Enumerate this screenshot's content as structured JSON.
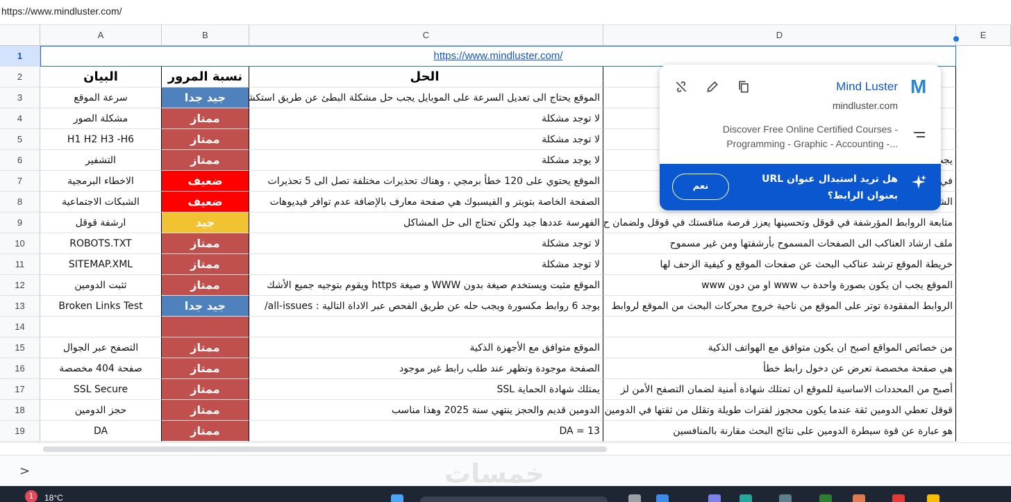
{
  "formula_bar": {
    "text": "https://www.mindluster.com/"
  },
  "columns": [
    "A",
    "B",
    "C",
    "D",
    "E"
  ],
  "row1": {
    "num": "1",
    "link": "https://www.mindluster.com/"
  },
  "header_row": {
    "num": "2",
    "a": "البيان",
    "b": "نسبة المرور",
    "c": "الحل",
    "d": ""
  },
  "rows": [
    {
      "num": "3",
      "a": "سرعة الموقع",
      "b": "جيد جدا",
      "b_color": "#4f81bd",
      "c": "الموقع يحتاج الى تعديل السرعة على الموبايل يجب حل مشكلة البطئ عن طريق استكشاف",
      "d": ""
    },
    {
      "num": "4",
      "a": "مشكلة الصور",
      "b": "ممتاز",
      "b_color": "#c0504d",
      "c": "لا توجد مشكلة",
      "d": ""
    },
    {
      "num": "5",
      "a": "H1 H2 H3 -H6",
      "b": "ممتاز",
      "b_color": "#c0504d",
      "c": "لا توجد مشكلة",
      "d": ""
    },
    {
      "num": "6",
      "a": "التشفير",
      "b": "ممتاز",
      "b_color": "#c0504d",
      "c": "لا يوجد مشكلة",
      "d": "يجب"
    },
    {
      "num": "7",
      "a": "الاخطاء البرمجية",
      "b": "ضعيف",
      "b_color": "#ff0000",
      "c": "الموقع يحتوي على 120 خطأ برمجي ، وهناك تحذيرات مختلفة تصل الى 5 تحذيرات",
      "d": "في الأرشفة وال"
    },
    {
      "num": "8",
      "a": "الشبكات الاجتماعية",
      "b": "ضعيف",
      "b_color": "#ff0000",
      "c": "الصفحة الخاصة بتويتر و الفيسبوك هي صفحة معارف بالإضافة عدم توافر فيديوهات",
      "d": "الشبكا"
    },
    {
      "num": "9",
      "a": "ارشفة قوقل",
      "b": "جيد",
      "b_color": "#f1c232",
      "c": "الفهرسة عددها جيد ولكن تحتاج الى حل المشاكل",
      "d": "متابعة الروابط المؤرشفة في قوقل وتحسينها يعزز فرصة منافستك في قوقل ولضمان ح"
    },
    {
      "num": "10",
      "a": "ROBOTS.TXT",
      "b": "ممتاز",
      "b_color": "#c0504d",
      "c": "لا توجد مشكلة",
      "d": "ملف ارشاد العناكب الى الصفحات المسموح بأرشفتها ومن غير مسموح"
    },
    {
      "num": "11",
      "a": "SITEMAP.XML",
      "b": "ممتاز",
      "b_color": "#c0504d",
      "c": "لا توجد مشكلة",
      "d": "خريطة الموقع ترشد عناكب البحث عن صفحات الموقع و كيفية الزحف لها"
    },
    {
      "num": "12",
      "a": "ثثبت الدومين",
      "b": "ممتاز",
      "b_color": "#c0504d",
      "c": "الموقع مثبت ويستخدم صيغة بدون WWW و صيغة https ويقوم بتوجيه جميع الأشك",
      "d": "الموقع يجب ان يكون بصورة واحدة ب www او من دون www"
    },
    {
      "num": "13",
      "a": "Broken Links Test",
      "b": "جيد جدا",
      "b_color": "#4f81bd",
      "c": "يوجد 6 روابط مكسورة ويجب حله عن طريق الفحص عبر الاداة التالية : all-issues/",
      "d": "الروابط المفقودة توتر على الموقع من ناحية خروج محركات البحث من الموقع لروابط"
    },
    {
      "num": "14",
      "a": "",
      "b": "",
      "b_color": "#c0504d",
      "c": "",
      "d": ""
    },
    {
      "num": "15",
      "a": "التصفح عبر الجوال",
      "b": "ممتاز",
      "b_color": "#c0504d",
      "c": "الموقع متوافق مع الأجهزة الذكية",
      "d": "من خصائص المواقع اصبح ان يكون متوافق مع الهواتف الذكية"
    },
    {
      "num": "16",
      "a": "صفحة 404 مخصصة",
      "b": "ممتاز",
      "b_color": "#c0504d",
      "c": "الصفحة موجودة وتظهر عند طلب رابط غير موجود",
      "d": "هي صفحة مخصصة تعرض عن دخول رابط خطأ"
    },
    {
      "num": "17",
      "a": "SSL Secure",
      "b": "ممتاز",
      "b_color": "#c0504d",
      "c": "يمتلك شهادة الحماية SSL",
      "d": "أصبح من المحددات الاساسية للموقع ان تمتلك شهادة أمنية لضمان التصفح الأمن لز"
    },
    {
      "num": "18",
      "a": "حجز الدومين",
      "b": "ممتاز",
      "b_color": "#c0504d",
      "c": "الدومين قديم والحجز ينتهي سنة 2025 وهذا مناسب",
      "d": "قوقل تعطي الدومين ثقة عندما يكون محجوز لفترات طويلة وتقلل من ثقتها في الدومين"
    },
    {
      "num": "19",
      "a": "DA",
      "b": "ممتاز",
      "b_color": "#c0504d",
      "c": "DA = 13",
      "d": "هو عبارة عن قوة سيطرة الدومين على نتائج البحث مقارنة بالمنافسين"
    }
  ],
  "link_popup": {
    "title": "Mind Luster",
    "domain": "mindluster.com",
    "description": "Discover Free Online Certified Courses - Programming - Graphic - Accounting -...",
    "banner_text": "هل تريد استبدال عنوان URL بعنوان الرابط؟",
    "yes_label": "نعم",
    "logo_letter": "M",
    "icons": [
      "unlink-icon",
      "edit-icon",
      "copy-icon",
      "sparkle-icon",
      "description-icon"
    ]
  },
  "sheet_bar": {
    "arrow": ">"
  },
  "watermark": "خمسات",
  "taskbar": {
    "weather_badge": "1",
    "temperature": "18°C"
  },
  "colors": {
    "accent": "#0b57d0",
    "link": "#1155cc",
    "selection": "#d3e3fd"
  }
}
